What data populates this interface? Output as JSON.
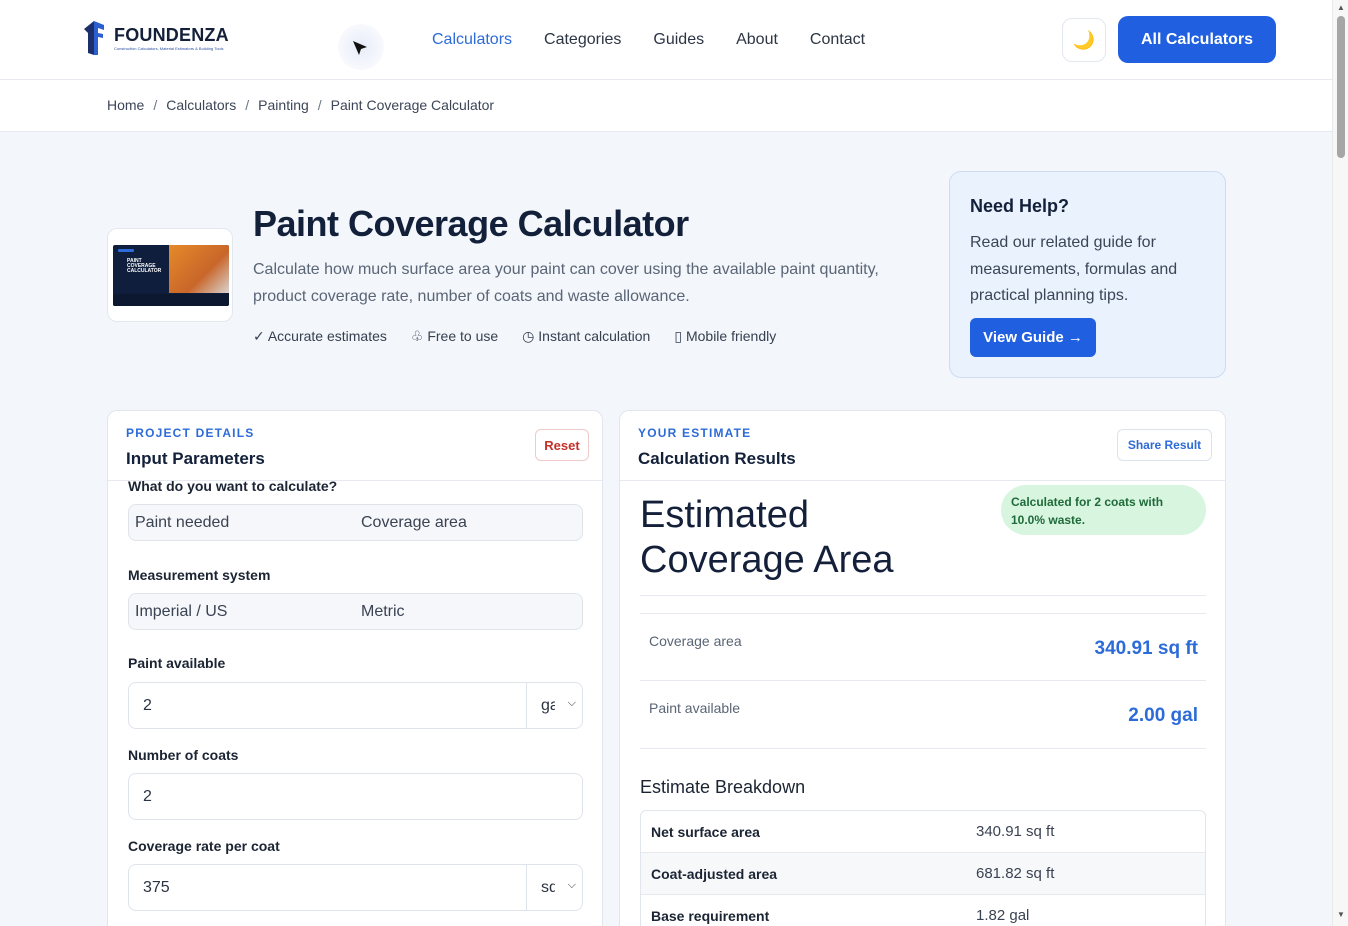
{
  "brand": {
    "name": "FOUNDENZA",
    "tagline": "Construction Calculators, Material Estimators & Building Tools"
  },
  "nav": {
    "items": [
      {
        "label": "Calculators",
        "active": true
      },
      {
        "label": "Categories",
        "active": false
      },
      {
        "label": "Guides",
        "active": false
      },
      {
        "label": "About",
        "active": false
      },
      {
        "label": "Contact",
        "active": false
      }
    ],
    "theme_icon": "🌙",
    "cta": "All Calculators"
  },
  "breadcrumb": [
    "Home",
    "Calculators",
    "Painting",
    "Paint Coverage Calculator"
  ],
  "hero": {
    "thumbnail_text": "PAINT COVERAGE CALCULATOR",
    "title": "Paint Coverage Calculator",
    "subtitle": "Calculate how much surface area your paint can cover using the available paint quantity, product coverage rate, number of coats and waste allowance.",
    "features": [
      "✓ Accurate estimates",
      "♧ Free to use",
      "◷ Instant calculation",
      "▯ Mobile friendly"
    ]
  },
  "help": {
    "title": "Need Help?",
    "body": "Read our related guide for measurements, formulas and practical planning tips.",
    "button": "View Guide →"
  },
  "inputs": {
    "eyebrow": "PROJECT DETAILS",
    "title": "Input Parameters",
    "reset": "Reset",
    "calc_label": "What do you want to calculate?",
    "calc_options": [
      "Paint needed",
      "Coverage area"
    ],
    "system_label": "Measurement system",
    "system_options": [
      "Imperial / US",
      "Metric"
    ],
    "paint_label": "Paint available",
    "paint_value": "2",
    "paint_unit": "gal",
    "coats_label": "Number of coats",
    "coats_value": "2",
    "rate_label": "Coverage rate per coat",
    "rate_value": "375",
    "rate_unit": "sq ft"
  },
  "results": {
    "eyebrow": "YOUR ESTIMATE",
    "title": "Calculation Results",
    "share": "Share Result",
    "headline": "Estimated Coverage Area",
    "badge": "Calculated for 2 coats with 10.0% waste.",
    "stats": [
      {
        "label": "Coverage area",
        "value": "340.91 sq ft"
      },
      {
        "label": "Paint available",
        "value": "2.00 gal"
      }
    ],
    "breakdown_title": "Estimate Breakdown",
    "breakdown": [
      {
        "key": "Net surface area",
        "value": "340.91 sq ft"
      },
      {
        "key": "Coat-adjusted area",
        "value": "681.82 sq ft"
      },
      {
        "key": "Base requirement",
        "value": "1.82 gal"
      }
    ]
  }
}
